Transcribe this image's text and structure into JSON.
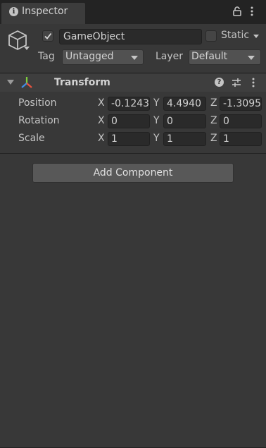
{
  "tab": {
    "title": "Inspector",
    "info_glyph": "i"
  },
  "object": {
    "active": true,
    "name": "GameObject",
    "static_label": "Static",
    "static": false,
    "tag_label": "Tag",
    "tag_value": "Untagged",
    "layer_label": "Layer",
    "layer_value": "Default"
  },
  "transform": {
    "title": "Transform",
    "help_glyph": "?",
    "rows": [
      {
        "label": "Position",
        "x": "-0.1243",
        "y": "4.4940",
        "z": "-1.3095"
      },
      {
        "label": "Rotation",
        "x": "0",
        "y": "0",
        "z": "0"
      },
      {
        "label": "Scale",
        "x": "1",
        "y": "1",
        "z": "1"
      }
    ],
    "axis_labels": {
      "x": "X",
      "y": "Y",
      "z": "Z"
    }
  },
  "actions": {
    "add_component": "Add Component"
  },
  "colors": {
    "panel_bg": "#383838",
    "tab_bar_bg": "#232323",
    "field_bg": "#2a2a2a",
    "button_bg": "#585858"
  },
  "icons": [
    "info-icon",
    "lock-icon",
    "kebab-menu-icon",
    "cube-icon",
    "checkmark-icon",
    "foldout-arrow-icon",
    "transform-axes-icon",
    "help-icon",
    "presets-icon"
  ]
}
